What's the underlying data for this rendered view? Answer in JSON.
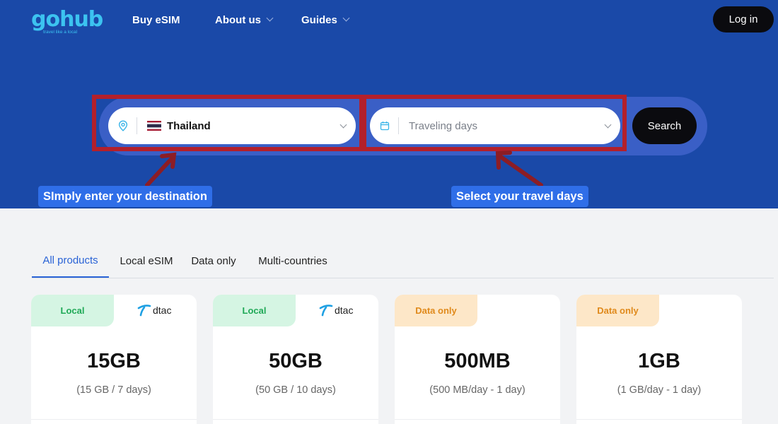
{
  "header": {
    "logo_text": "gohub",
    "logo_tagline": "travel like a local",
    "nav": [
      {
        "label": "Buy eSIM",
        "has_dropdown": false
      },
      {
        "label": "About us",
        "has_dropdown": true
      },
      {
        "label": "Guides",
        "has_dropdown": true
      }
    ],
    "login_label": "Log in"
  },
  "search": {
    "destination_icon": "location-pin-icon",
    "destination_value": "Thailand",
    "days_icon": "calendar-icon",
    "days_placeholder": "Traveling days",
    "search_label": "Search"
  },
  "annotations": {
    "destination_callout": "SImply enter your destination",
    "days_callout": "Select your travel days",
    "highlight_color": "#b3202b",
    "callout_color": "#2f6ee8"
  },
  "tabs": [
    {
      "label": "All products",
      "active": true
    },
    {
      "label": "Local eSIM",
      "active": false
    },
    {
      "label": "Data only",
      "active": false
    },
    {
      "label": "Multi-countries",
      "active": false
    }
  ],
  "products": [
    {
      "badge": "Local",
      "badge_type": "local",
      "carrier": "dtac",
      "size": "15GB",
      "detail": "(15 GB / 7 days)"
    },
    {
      "badge": "Local",
      "badge_type": "local",
      "carrier": "dtac",
      "size": "50GB",
      "detail": "(50 GB / 10 days)"
    },
    {
      "badge": "Data only",
      "badge_type": "data",
      "carrier": "",
      "size": "500MB",
      "detail": "(500 MB/day - 1 day)"
    },
    {
      "badge": "Data only",
      "badge_type": "data",
      "carrier": "",
      "size": "1GB",
      "detail": "(1 GB/day - 1 day)"
    }
  ],
  "colors": {
    "hero_bg": "#1a49a8",
    "accent_blue": "#2a63d6",
    "logo": "#3cc3f0"
  }
}
